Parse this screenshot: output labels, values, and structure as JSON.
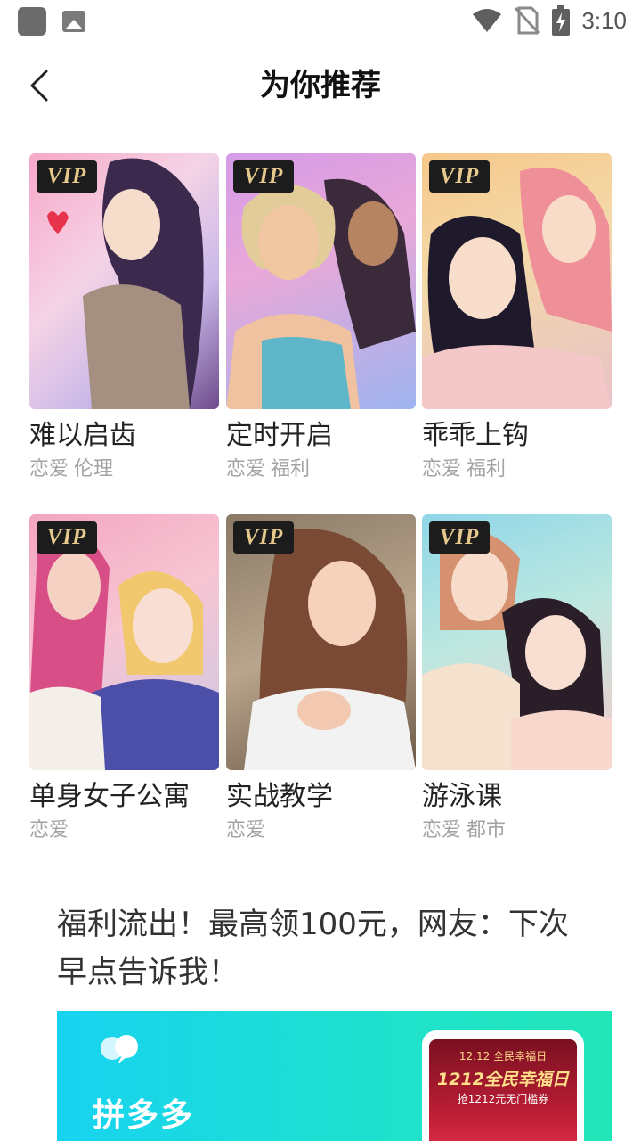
{
  "status_bar": {
    "time": "3:10",
    "icons": [
      "app-icon",
      "gallery-icon",
      "wifi-icon",
      "no-sim-icon",
      "battery-charging-icon"
    ]
  },
  "header": {
    "title": "为你推荐",
    "back_icon": "back-chevron-icon"
  },
  "badge_label": "VIP",
  "comics": [
    {
      "title": "难以启齿",
      "tags": [
        "恋爱",
        "伦理"
      ]
    },
    {
      "title": "定时开启",
      "tags": [
        "恋爱",
        "福利"
      ]
    },
    {
      "title": "乖乖上钩",
      "tags": [
        "恋爱",
        "福利"
      ]
    },
    {
      "title": "单身女子公寓",
      "tags": [
        "恋爱"
      ]
    },
    {
      "title": "实战教学",
      "tags": [
        "恋爱"
      ]
    },
    {
      "title": "游泳课",
      "tags": [
        "恋爱",
        "都市"
      ]
    }
  ],
  "article": {
    "title": "福利流出！最高领100元，网友：下次早点告诉我！",
    "banner": {
      "brand": "拼多多",
      "phone_top": "12.12 全民幸福日",
      "phone_headline": "1212全民幸福日",
      "phone_sub": "抢1212元无门槛券"
    }
  },
  "colors": {
    "accent_vip": "#e6c98d",
    "tag_gray": "#a3a3a3",
    "banner_start": "#17d3f0",
    "banner_end": "#22e6b8"
  }
}
